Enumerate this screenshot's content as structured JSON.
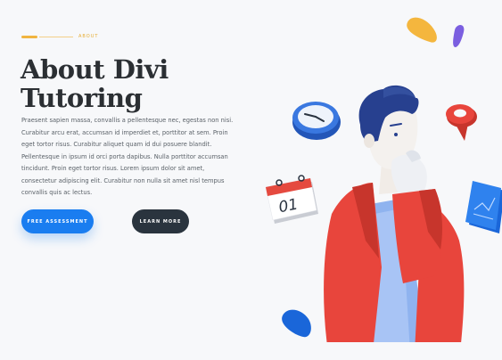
{
  "eyebrow": {
    "label": "ABOUT"
  },
  "hero": {
    "title_line1": "About Divi",
    "title_line2": "Tutoring",
    "body": "Praesent sapien massa, convallis a pellentesque nec, egestas non nisi. Curabitur arcu erat, accumsan id imperdiet et, porttitor at sem. Proin eget tortor risus. Curabitur aliquet quam id dui posuere blandit. Pellentesque in ipsum id orci porta dapibus. Nulla porttitor accumsan tincidunt. Proin eget tortor risus. Lorem ipsum dolor sit amet, consectetur adipiscing elit. Curabitur non nulla sit amet nisl tempus convallis quis ac lectus."
  },
  "buttons": {
    "primary": "FREE ASSESSMENT",
    "secondary": "LEARN MORE"
  },
  "illustration": {
    "calendar_day": "01",
    "icons": [
      "clock-icon",
      "calendar-icon",
      "map-pin-icon",
      "chart-card-icon",
      "thinking-person"
    ]
  },
  "colors": {
    "accent_yellow": "#f0b440",
    "primary_blue": "#1a7df0",
    "dark_button": "#2a343e",
    "heading": "#2b2f33",
    "jacket_red": "#e8453c",
    "hair_navy": "#27408f",
    "purple": "#7b5fe0"
  }
}
